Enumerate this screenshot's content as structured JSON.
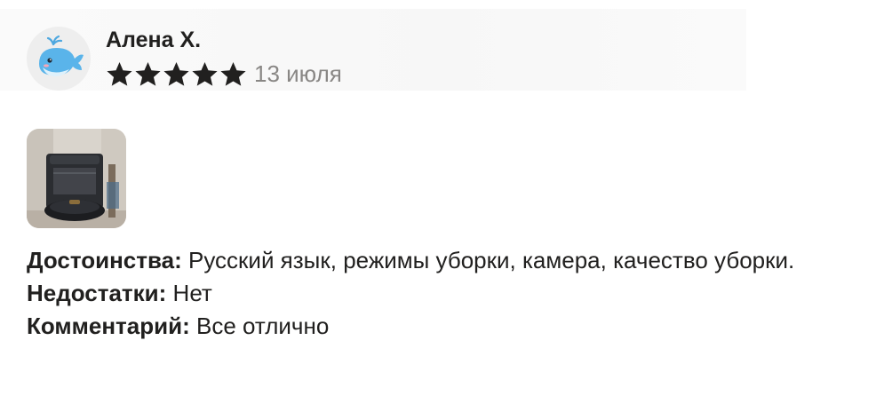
{
  "review": {
    "author": "Алена Х.",
    "rating": 5,
    "rating_max": 5,
    "date": "13 июля",
    "avatar_icon": "whale-avatar-icon",
    "photo": "robot-vacuum-photo",
    "pros_label": "Достоинства:",
    "pros_text": " Русский язык, режимы уборки, камера, качество уборки.",
    "cons_label": "Недостатки:",
    "cons_text": " Нет",
    "comment_label": "Комментарий:",
    "comment_text": " Все отлично"
  },
  "colors": {
    "text": "#21201f",
    "date": "#898785",
    "star": "#21201f"
  }
}
